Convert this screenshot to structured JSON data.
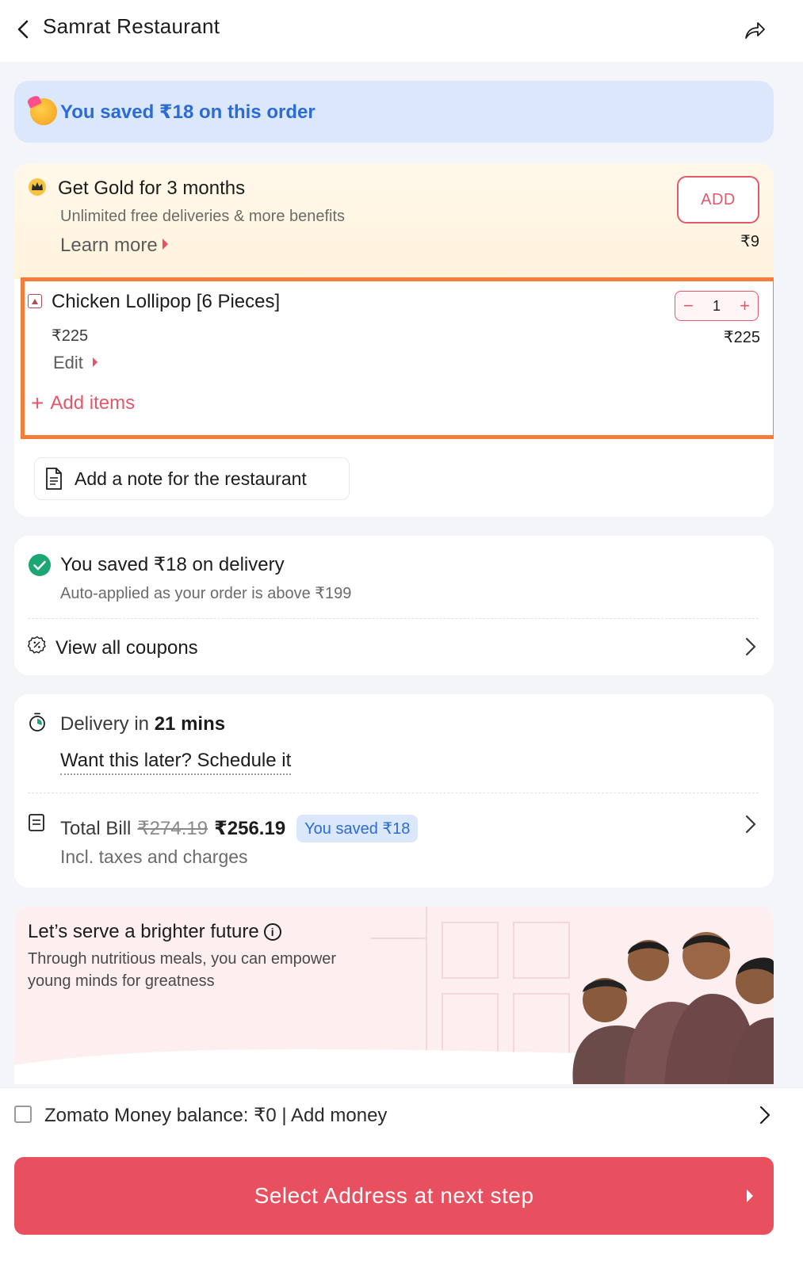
{
  "header": {
    "title": "Samrat Restaurant",
    "back_icon": "chevron-left-icon",
    "share_icon": "share-arrow-icon"
  },
  "savings_banner": {
    "text": "You saved ₹18 on this order",
    "icon": "party-face-icon"
  },
  "gold": {
    "icon": "crown-icon",
    "title": "Get Gold for 3 months",
    "subtitle": "Unlimited free deliveries & more benefits",
    "learn_more": "Learn more",
    "add_label": "ADD",
    "price": "₹9"
  },
  "cart_item": {
    "icon": "non-veg-icon",
    "name": "Chicken Lollipop [6 Pieces]",
    "unit_price": "₹225",
    "edit_label": "Edit",
    "quantity": "1",
    "decrement": "−",
    "increment": "+",
    "line_total": "₹225"
  },
  "add_items": {
    "plus": "+",
    "label": "Add items"
  },
  "note": {
    "icon": "note-document-icon",
    "label": "Add a note for the restaurant"
  },
  "coupons": {
    "applied_title": "You saved ₹18 on delivery",
    "applied_sub": "Auto-applied as your order is above ₹199",
    "view_all": "View all coupons",
    "colors": {
      "success": "#1ba672"
    }
  },
  "delivery": {
    "prefix": "Delivery in ",
    "eta": "21 mins",
    "schedule": "Want this later? Schedule it"
  },
  "bill": {
    "label": "Total Bill",
    "original": "₹274.19",
    "final": "₹256.19",
    "saved_chip": "You saved ₹18",
    "subtext": "Incl. taxes and charges"
  },
  "future": {
    "title": "Let’s serve a brighter future",
    "subtitle": "Through nutritious meals, you can empower young minds for greatness"
  },
  "wallet": {
    "label": "Zomato Money balance: ₹0 | Add money"
  },
  "cta": {
    "label": "Select Address at next step",
    "color": "#e8505f"
  }
}
